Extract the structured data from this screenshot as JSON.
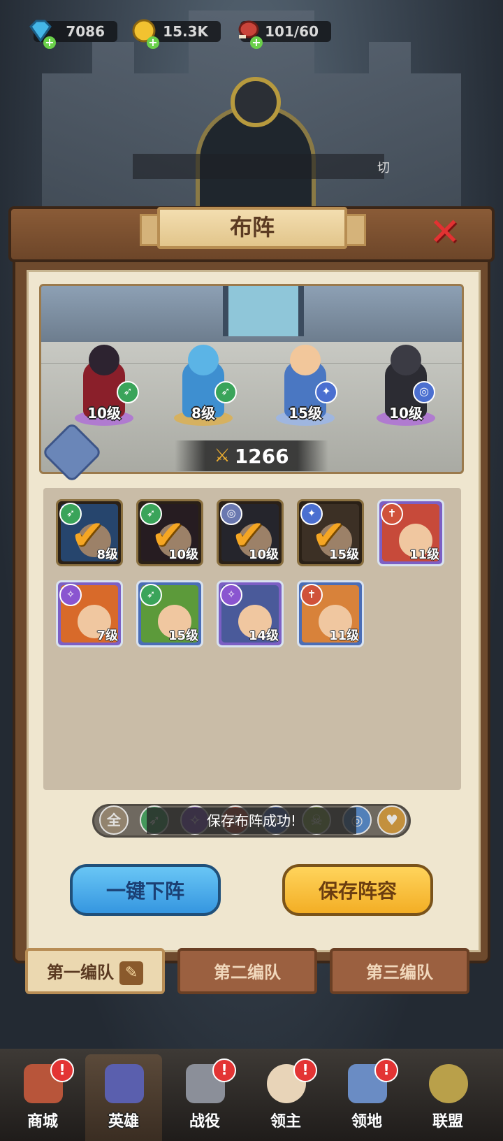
{
  "resources": {
    "gems": "7086",
    "gold": "15.3K",
    "meat": "101/60"
  },
  "notice_glyph": "切",
  "dialog": {
    "title": "布阵",
    "close_icon": "close-x-icon"
  },
  "arena": {
    "heroes": [
      {
        "level": "10级",
        "class_icon": "bow-icon",
        "class_color": "#3aa45a"
      },
      {
        "level": "8级",
        "class_icon": "bow-icon",
        "class_color": "#3aa45a"
      },
      {
        "level": "15级",
        "class_icon": "paw-icon",
        "class_color": "#4b6fd0"
      },
      {
        "level": "10级",
        "class_icon": "swirl-icon",
        "class_color": "#4b6fd0"
      }
    ],
    "power": "1266"
  },
  "hero_cards": [
    {
      "level": "8级",
      "selected": true,
      "elem_icon": "bow-icon",
      "elem_color": "#3aa45a"
    },
    {
      "level": "10级",
      "selected": true,
      "elem_icon": "bow-icon",
      "elem_color": "#3aa45a"
    },
    {
      "level": "10级",
      "selected": true,
      "elem_icon": "swirl-icon",
      "elem_color": "#6a78b0"
    },
    {
      "level": "15级",
      "selected": true,
      "elem_icon": "paw-icon",
      "elem_color": "#4b6fd0"
    },
    {
      "level": "11级",
      "selected": false,
      "elem_icon": "cross-icon",
      "elem_color": "#d0523a"
    },
    {
      "level": "7级",
      "selected": false,
      "elem_icon": "staff-icon",
      "elem_color": "#8a55d0"
    },
    {
      "level": "15级",
      "selected": false,
      "elem_icon": "bow-icon",
      "elem_color": "#3aa45a"
    },
    {
      "level": "14级",
      "selected": false,
      "elem_icon": "staff-icon",
      "elem_color": "#8a55d0"
    },
    {
      "level": "11级",
      "selected": false,
      "elem_icon": "cross-icon",
      "elem_color": "#d0523a"
    }
  ],
  "filter": {
    "all_label": "全",
    "toast": "保存布阵成功!"
  },
  "buttons": {
    "unequip_all": "一键下阵",
    "save_lineup": "保存阵容"
  },
  "tabs": [
    "第一编队",
    "第二编队",
    "第三编队"
  ],
  "nav": [
    "商城",
    "英雄",
    "战役",
    "领主",
    "领地",
    "联盟"
  ],
  "colors": {
    "accent_blue": "#3596e0",
    "accent_yellow": "#f3ae25",
    "panel_brown": "#6e4a2d",
    "paper": "#efe6cf",
    "alert_red": "#e33434"
  }
}
